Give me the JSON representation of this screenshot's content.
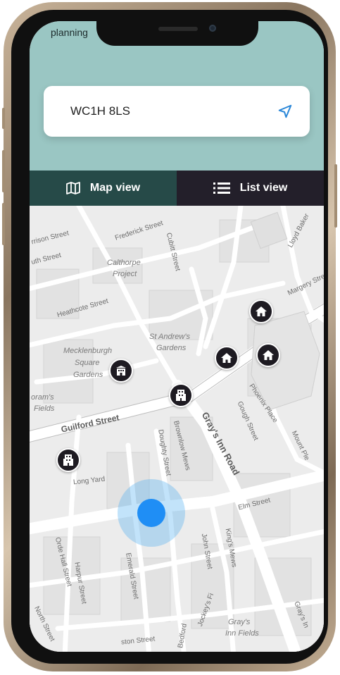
{
  "status_bar": {
    "text": "planning"
  },
  "search": {
    "value": "WC1H 8LS"
  },
  "tabs": [
    {
      "label": "Map view",
      "icon": "map-icon",
      "active": true
    },
    {
      "label": "List view",
      "icon": "list-icon",
      "active": false
    }
  ],
  "map": {
    "place_labels": [
      "Calthorpe",
      "Project",
      "St Andrew's",
      "Gardens",
      "Mecklenburgh",
      "Square",
      "Gardens",
      "oram's",
      "Fields",
      "Gray's",
      "Inn Fields"
    ],
    "street_labels": [
      "Frederick Street",
      "rrison Street",
      "uth Street",
      "Heathcote Street",
      "Guilford Street",
      "Long Yard",
      "Gray's Inn Road",
      "Elm Street",
      "Phoenix Place",
      "Gough Street",
      "Margery Street",
      "Lloyd Baker",
      "Cubitt Street",
      "Doughty Street",
      "Brownlow Mews",
      "Mount Ple",
      "Orde Hall Street",
      "Harpur Street",
      "Emerald Street",
      "John Street",
      "King's Mews",
      "Jockey's Fi",
      "Bedford",
      "North Street",
      "ston Street",
      "Gray's In"
    ],
    "pins": [
      {
        "type": "house-icon"
      },
      {
        "type": "house-icon"
      },
      {
        "type": "house-icon"
      },
      {
        "type": "building-icon"
      },
      {
        "type": "building-icon"
      },
      {
        "type": "building-icon"
      }
    ],
    "current_location": "current-location-dot"
  },
  "colors": {
    "header": "#9ac6c3",
    "tab_active": "#264a48",
    "tab_inactive": "#231f2a",
    "pin": "#1e1b22",
    "location": "#1f8ef5",
    "locate_icon": "#2a87d8"
  }
}
